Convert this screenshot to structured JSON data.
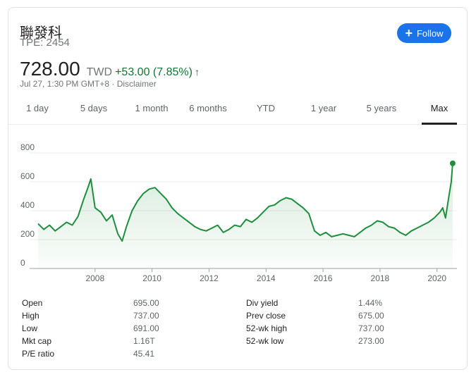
{
  "stock": {
    "name": "聯發科",
    "ticker": "TPE: 2454",
    "price": "728.00",
    "currency": "TWD",
    "change": "+53.00 (7.85%)",
    "timestamp": "Jul 27, 1:30 PM GMT+8 · Disclaimer"
  },
  "follow": {
    "label": "Follow"
  },
  "tabs": [
    {
      "label": "1 day"
    },
    {
      "label": "5 days"
    },
    {
      "label": "1 month"
    },
    {
      "label": "6 months"
    },
    {
      "label": "YTD"
    },
    {
      "label": "1 year"
    },
    {
      "label": "5 years"
    },
    {
      "label": "Max",
      "active": true
    }
  ],
  "colors": {
    "line": "#1e8e3e",
    "accent": "#1a73e8",
    "up": "#137333"
  },
  "chart_data": {
    "type": "line",
    "yticks": [
      "800",
      "600",
      "400",
      "200",
      "0"
    ],
    "xticks": [
      "2008",
      "2010",
      "2012",
      "2014",
      "2016",
      "2018",
      "2020"
    ],
    "ylim": [
      0,
      800
    ],
    "xlim": [
      2006.0,
      2020.7
    ],
    "grid": true,
    "series": [
      {
        "x": [
          2006.0,
          2006.2,
          2006.4,
          2006.6,
          2006.8,
          2007.0,
          2007.2,
          2007.4,
          2007.6,
          2007.75,
          2007.85,
          2008.0,
          2008.2,
          2008.4,
          2008.6,
          2008.8,
          2008.95,
          2009.1,
          2009.3,
          2009.5,
          2009.7,
          2009.9,
          2010.1,
          2010.3,
          2010.5,
          2010.7,
          2010.9,
          2011.1,
          2011.3,
          2011.5,
          2011.7,
          2011.9,
          2012.1,
          2012.3,
          2012.5,
          2012.7,
          2012.9,
          2013.1,
          2013.3,
          2013.5,
          2013.7,
          2013.9,
          2014.1,
          2014.3,
          2014.5,
          2014.7,
          2014.9,
          2015.1,
          2015.3,
          2015.5,
          2015.7,
          2015.9,
          2016.1,
          2016.3,
          2016.5,
          2016.7,
          2016.9,
          2017.1,
          2017.3,
          2017.5,
          2017.7,
          2017.9,
          2018.1,
          2018.3,
          2018.5,
          2018.7,
          2018.9,
          2019.1,
          2019.3,
          2019.5,
          2019.7,
          2019.9,
          2020.1,
          2020.2,
          2020.3,
          2020.4,
          2020.5,
          2020.55
        ],
        "y": [
          310,
          270,
          300,
          260,
          290,
          320,
          300,
          360,
          480,
          560,
          620,
          420,
          390,
          330,
          370,
          240,
          190,
          290,
          400,
          470,
          520,
          550,
          560,
          520,
          480,
          420,
          380,
          350,
          320,
          290,
          270,
          260,
          280,
          300,
          250,
          270,
          300,
          290,
          340,
          320,
          350,
          390,
          430,
          440,
          470,
          490,
          480,
          450,
          420,
          380,
          260,
          230,
          250,
          220,
          230,
          240,
          230,
          220,
          250,
          280,
          300,
          330,
          320,
          290,
          280,
          250,
          230,
          260,
          280,
          300,
          320,
          350,
          390,
          420,
          350,
          480,
          600,
          728
        ]
      }
    ]
  },
  "stats": {
    "left": [
      {
        "label": "Open",
        "value": "695.00"
      },
      {
        "label": "High",
        "value": "737.00"
      },
      {
        "label": "Low",
        "value": "691.00"
      },
      {
        "label": "Mkt cap",
        "value": "1.16T"
      },
      {
        "label": "P/E ratio",
        "value": "45.41"
      }
    ],
    "right": [
      {
        "label": "Div yield",
        "value": "1.44%"
      },
      {
        "label": "Prev close",
        "value": "675.00"
      },
      {
        "label": "52-wk high",
        "value": "737.00"
      },
      {
        "label": "52-wk low",
        "value": "273.00"
      }
    ]
  }
}
